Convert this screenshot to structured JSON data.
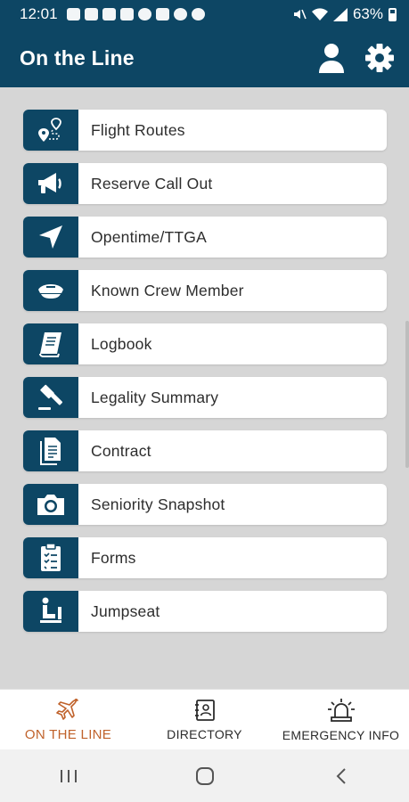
{
  "status_bar": {
    "time": "12:01",
    "battery": "63%"
  },
  "app_bar": {
    "title": "On the Line",
    "profile_icon": "person-icon",
    "settings_icon": "gear-icon"
  },
  "colors": {
    "primary": "#0d4664",
    "background": "#d6d6d6",
    "active_tab": "#c0622b"
  },
  "menu": {
    "items": [
      {
        "label": "Flight Routes",
        "icon": "route-pin-icon"
      },
      {
        "label": "Reserve Call Out",
        "icon": "megaphone-icon"
      },
      {
        "label": "Opentime/TTGA",
        "icon": "navigation-arrow-icon"
      },
      {
        "label": "Known Crew Member",
        "icon": "pilot-cap-icon"
      },
      {
        "label": "Logbook",
        "icon": "book-icon"
      },
      {
        "label": "Legality Summary",
        "icon": "gavel-icon"
      },
      {
        "label": "Contract",
        "icon": "document-icon"
      },
      {
        "label": "Seniority Snapshot",
        "icon": "camera-icon"
      },
      {
        "label": "Forms",
        "icon": "clipboard-checklist-icon"
      },
      {
        "label": "Jumpseat",
        "icon": "seat-icon"
      }
    ]
  },
  "bottom_nav": {
    "tabs": [
      {
        "label": "ON THE LINE",
        "icon": "airplane-icon",
        "active": true
      },
      {
        "label": "DIRECTORY",
        "icon": "contact-book-icon",
        "active": false
      },
      {
        "label": "EMERGENCY INFO",
        "icon": "siren-icon",
        "active": false
      }
    ]
  }
}
